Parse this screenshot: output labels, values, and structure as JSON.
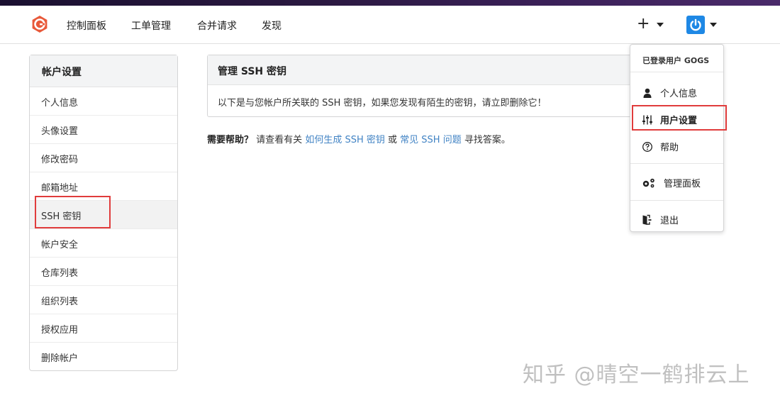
{
  "nav": {
    "items": [
      "控制面板",
      "工单管理",
      "合并请求",
      "发现"
    ],
    "plus": "+"
  },
  "sidebar": {
    "title": "帐户设置",
    "items": [
      {
        "label": "个人信息"
      },
      {
        "label": "头像设置"
      },
      {
        "label": "修改密码"
      },
      {
        "label": "邮箱地址"
      },
      {
        "label": "SSH 密钥"
      },
      {
        "label": "帐户安全"
      },
      {
        "label": "仓库列表"
      },
      {
        "label": "组织列表"
      },
      {
        "label": "授权应用"
      },
      {
        "label": "删除帐户"
      }
    ]
  },
  "panel": {
    "title": "管理 SSH 密钥",
    "body": "以下是与您帐户所关联的 SSH 密钥，如果您发现有陌生的密钥，请立即删除它！"
  },
  "help": {
    "prefix": "需要帮助？",
    "text1": "请查看有关",
    "link1": "如何生成 SSH 密钥",
    "or": "或",
    "link2": "常见 SSH 问题",
    "suffix": "寻找答案。"
  },
  "dropdown": {
    "header": "已登录用户 GOGS",
    "items": [
      {
        "label": "个人信息",
        "icon": "user-icon"
      },
      {
        "label": "用户设置",
        "icon": "sliders-icon"
      },
      {
        "label": "帮助",
        "icon": "help-icon"
      },
      {
        "label": "管理面板",
        "icon": "gears-icon"
      },
      {
        "label": "退出",
        "icon": "sign-out-icon"
      }
    ]
  },
  "watermark": "知乎 @晴空一鹤排云上",
  "colors": {
    "highlight": "#e03c3c",
    "link": "#4183c4",
    "avatar": "#1e88e5",
    "logo": "#e8593a"
  }
}
